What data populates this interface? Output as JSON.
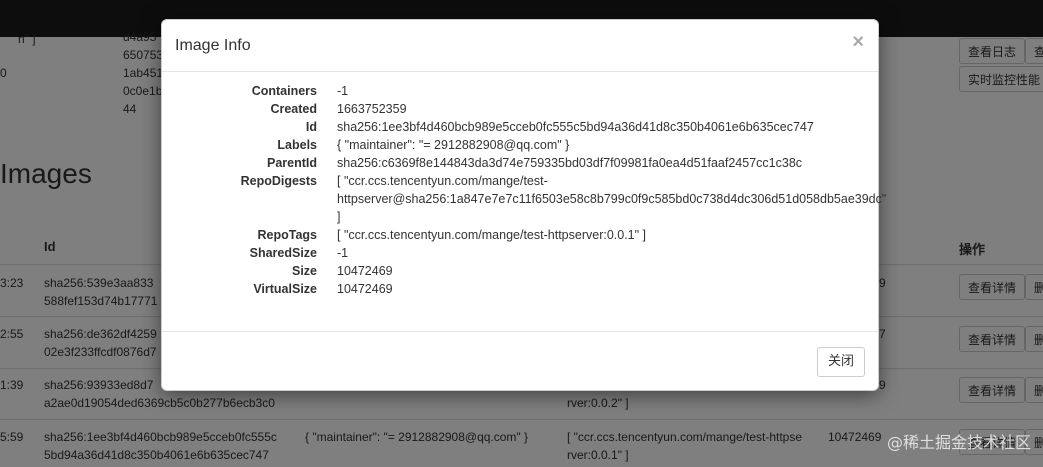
{
  "background": {
    "top_cells": [
      "d4a95",
      "650753",
      "1ab451",
      "0c0e1b",
      "44"
    ],
    "top_left": [
      "n\" ]",
      "0"
    ],
    "top_buttons": [
      "查看日志",
      "查",
      "实时监控性能"
    ],
    "heading": "Images",
    "columns": {
      "id": "Id",
      "ops": "操作"
    },
    "rows": [
      {
        "time": "3:23",
        "id1": "sha256:539e3aa833",
        "id2": "588fef153d74b17771",
        "labels": "",
        "tags1": "",
        "tags2": "",
        "size": "9",
        "btn": "查看详情",
        "btn2": "删"
      },
      {
        "time": "2:55",
        "id1": "sha256:de362df4259",
        "id2": "02e3f233ffcdf0876d7",
        "labels": "",
        "tags1": "",
        "tags2": "",
        "size": "7",
        "btn": "查看详情",
        "btn2": "删"
      },
      {
        "time": "1:39",
        "id1": "sha256:93933ed8d7",
        "id2": "a2ae0d19054ded6369cb5c0b277b6ecb3c0",
        "labels": "",
        "tags1": "",
        "tags2": "rver:0.0.2\" ]",
        "size": "9",
        "btn": "查看详情",
        "btn2": "删"
      },
      {
        "time": "5:59",
        "id1": "sha256:1ee3bf4d460bcb989e5cceb0fc555c",
        "id2": "5bd94a36d41d8c350b4061e6b635cec747",
        "labels": "{ \"maintainer\": \"= 2912882908@qq.com\" }",
        "tags1": "[ \"ccr.ccs.tencentyun.com/mange/test-httpse",
        "tags2": "rver:0.0.1\" ]",
        "size": "10472469",
        "btn": "查看详情",
        "btn2": "删"
      }
    ]
  },
  "modal": {
    "title": "Image Info",
    "close_symbol": "×",
    "fields": [
      {
        "key": "Containers",
        "value": "-1"
      },
      {
        "key": "Created",
        "value": "1663752359"
      },
      {
        "key": "Id",
        "value": "sha256:1ee3bf4d460bcb989e5cceb0fc555c5bd94a36d41d8c350b4061e6b635cec747"
      },
      {
        "key": "Labels",
        "value": "{ \"maintainer\": \"= 2912882908@qq.com\" }"
      },
      {
        "key": "ParentId",
        "value": "sha256:c6369f8e144843da3d74e759335bd03df7f09981fa0ea4d51faaf2457cc1c38c"
      },
      {
        "key": "RepoDigests",
        "lines": [
          "[ \"ccr.ccs.tencentyun.com/mange/test-",
          "httpserver@sha256:1a847e7e7c11f6503e58c8b799c0f9c585bd0c738d4dc306d51d058db5ae39dc\"",
          "]"
        ]
      },
      {
        "key": "RepoTags",
        "value": "[ \"ccr.ccs.tencentyun.com/mange/test-httpserver:0.0.1\" ]"
      },
      {
        "key": "SharedSize",
        "value": "-1"
      },
      {
        "key": "Size",
        "value": "10472469"
      },
      {
        "key": "VirtualSize",
        "value": "10472469"
      }
    ],
    "close_button": "关闭"
  },
  "watermark": "@稀土掘金技术社区"
}
